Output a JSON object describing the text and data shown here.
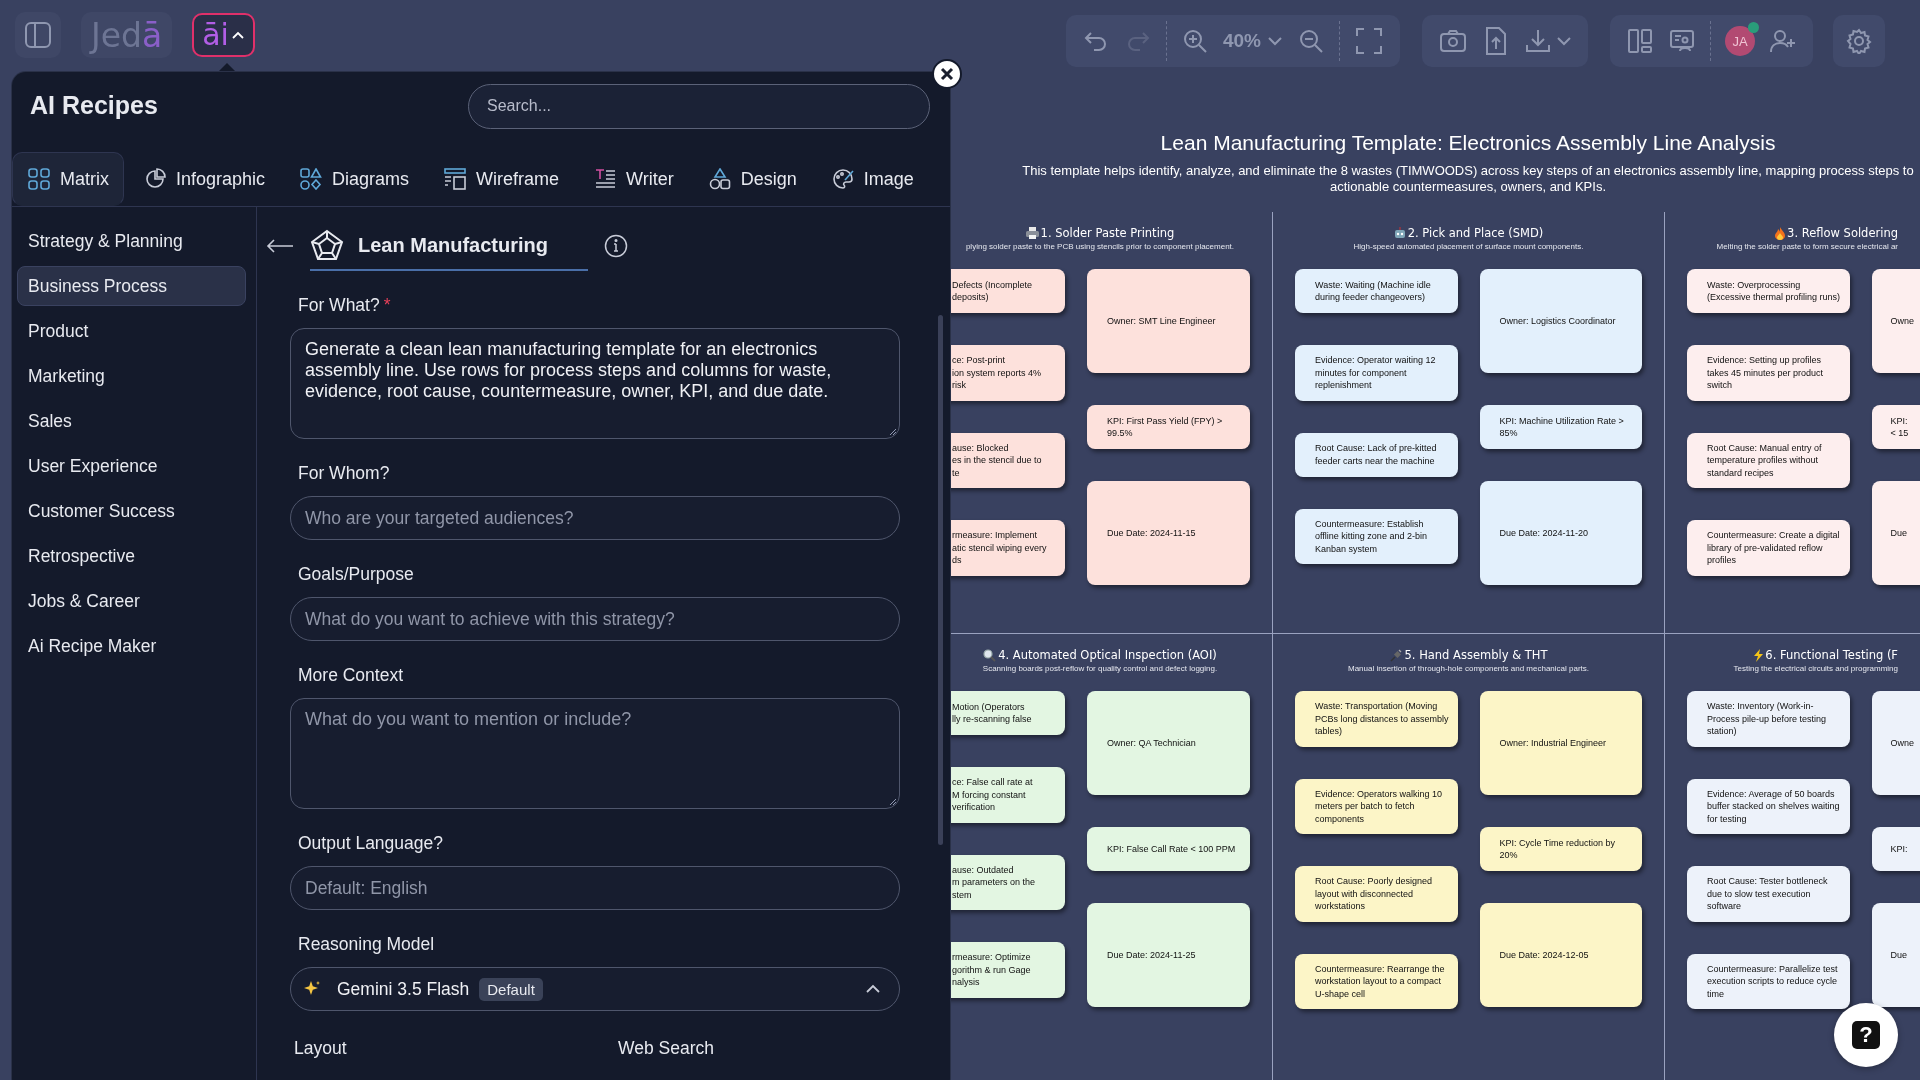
{
  "top_left": {
    "logo": {
      "text": "Jed",
      "accent": "ā"
    },
    "ai_button": {
      "text": "āi",
      "expanded": true
    }
  },
  "toolbar": {
    "undo": {
      "disabled": false
    },
    "redo": {
      "disabled": true
    },
    "zoom": "40%",
    "avatar": {
      "initials": "JA",
      "online": true
    }
  },
  "panel": {
    "title": "AI Recipes",
    "search": {
      "placeholder": "Search..."
    },
    "tabs": [
      {
        "label": "Matrix",
        "kind": "matrix",
        "selected": true
      },
      {
        "label": "Infographic",
        "kind": "infographic",
        "selected": false
      },
      {
        "label": "Diagrams",
        "kind": "diagrams",
        "selected": false
      },
      {
        "label": "Wireframe",
        "kind": "wireframe",
        "selected": false
      },
      {
        "label": "Writer",
        "kind": "writer",
        "selected": false
      },
      {
        "label": "Design",
        "kind": "design",
        "selected": false
      },
      {
        "label": "Image",
        "kind": "image",
        "selected": false
      }
    ],
    "categories": [
      {
        "label": "Strategy & Planning",
        "selected": false
      },
      {
        "label": "Business Process",
        "selected": true
      },
      {
        "label": "Product",
        "selected": false
      },
      {
        "label": "Marketing",
        "selected": false
      },
      {
        "label": "Sales",
        "selected": false
      },
      {
        "label": "User Experience",
        "selected": false
      },
      {
        "label": "Customer Success",
        "selected": false
      },
      {
        "label": "Retrospective",
        "selected": false
      },
      {
        "label": "Jobs & Career",
        "selected": false
      },
      {
        "label": "Ai Recipe Maker",
        "selected": false
      }
    ],
    "recipe": {
      "title": "Lean Manufacturing"
    },
    "required_mark": "*",
    "fields": [
      {
        "kind": "textarea",
        "label": "For What?",
        "required": true,
        "value": "Generate a clean lean manufacturing template for an electronics assembly line. Use rows for process steps and columns for waste, evidence, root cause, countermeasure, owner, KPI, and due date."
      },
      {
        "kind": "input",
        "label": "For Whom?",
        "placeholder": "Who are your targeted audiences?"
      },
      {
        "kind": "input",
        "label": "Goals/Purpose",
        "placeholder": "What do you want to achieve with this strategy?"
      },
      {
        "kind": "textarea",
        "label": "More Context",
        "placeholder": "What do you want to mention or include?"
      },
      {
        "kind": "input",
        "label": "Output Language?",
        "placeholder": "Default: English"
      },
      {
        "kind": "select",
        "label": "Reasoning Model",
        "value": "Gemini 3.5 Flash",
        "badge": "Default",
        "expanded": true
      }
    ],
    "more_labels": [
      "Layout",
      "Web Search"
    ]
  },
  "canvas": {
    "title": "Lean Manufacturing Template: Electronics Assembly Line Analysis",
    "description": "This template helps identify, analyze, and eliminate the 8 wastes (TIMWOODS) across key steps of an electronics assembly line, mapping process steps to actionable countermeasures, owners, and KPIs.",
    "rows": [
      {
        "columns": [
          {
            "kind": "printing",
            "color": "#fde1dc",
            "title": "1. Solder Paste Printing",
            "description": "plying solder paste to the PCB using stencils prior to component placement.",
            "left_cards": [
              "Defects (Incomplete\ndeposits)",
              "ce: Post-print\nion system reports 4%\nrisk",
              "ause: Blocked\nes in the stencil due to\nte",
              "rmeasure: Implement\natic stencil wiping every\nds"
            ],
            "right_cards": [
              "Owner: SMT Line Engineer",
              "KPI: First Pass Yield (FPY) > 99.5%",
              "Due Date: 2024-11-15"
            ]
          },
          {
            "kind": "placement",
            "color": "#e3f0fc",
            "title": "2. Pick and Place (SMD)",
            "description": "High-speed automated placement of surface mount components.",
            "left_cards": [
              "Waste: Waiting (Machine idle during feeder changeovers)",
              "Evidence: Operator waiting 12 minutes for component replenishment",
              "Root Cause: Lack of pre-kitted feeder carts near the machine",
              "Countermeasure: Establish offline kitting zone and 2-bin Kanban system"
            ],
            "right_cards": [
              "Owner: Logistics Coordinator",
              "KPI: Machine Utilization Rate > 85%",
              "Due Date: 2024-11-20"
            ]
          },
          {
            "kind": "reflow",
            "color": "#fdeeee",
            "title": "3. Reflow Soldering",
            "description": "Melting the solder paste to form secure electrical ar",
            "left_cards": [
              "Waste: Overprocessing (Excessive thermal profiling runs)",
              "Evidence: Setting up profiles takes 45 minutes per product switch",
              "Root Cause: Manual entry of temperature profiles without standard recipes",
              "Countermeasure: Create a digital library of pre-validated reflow profiles"
            ],
            "right_cards": [
              "Owne",
              "KPI:\n< 15",
              "Due"
            ]
          }
        ]
      },
      {
        "columns": [
          {
            "kind": "inspection",
            "color": "#e3f6e2",
            "title": "4. Automated Optical Inspection (AOI)",
            "description": "Scanning boards post-reflow for quality control and defect logging.",
            "left_cards": [
              "Motion (Operators\nlly re-scanning false",
              "ce: False call rate at\nM forcing constant\nverification",
              "ause: Outdated\nm parameters on the\nstem",
              "rmeasure: Optimize\ngorithm & run Gage\nnalysis"
            ],
            "right_cards": [
              "Owner: QA Technician",
              "KPI: False Call Rate < 100 PPM",
              "Due Date: 2024-11-25"
            ]
          },
          {
            "kind": "assembly",
            "color": "#fcf5c7",
            "title": "5. Hand Assembly & THT",
            "description": "Manual insertion of through-hole components and mechanical parts.",
            "left_cards": [
              "Waste: Transportation (Moving PCBs long distances to assembly tables)",
              "Evidence: Operators walking 10 meters per batch to fetch components",
              "Root Cause: Poorly designed layout with disconnected workstations",
              "Countermeasure: Rearrange the workstation layout to a compact U-shape cell"
            ],
            "right_cards": [
              "Owner: Industrial Engineer",
              "KPI: Cycle Time reduction by 20%",
              "Due Date: 2024-12-05"
            ]
          },
          {
            "kind": "testing",
            "color": "#edf2fa",
            "title": "6. Functional Testing (F",
            "description": "Testing the electrical circuits and programming",
            "left_cards": [
              "Waste: Inventory (Work-in-Process pile-up before testing station)",
              "Evidence: Average of 50 boards buffer stacked on shelves waiting for testing",
              "Root Cause: Tester bottleneck due to slow test execution software",
              "Countermeasure: Parallelize test execution scripts to reduce cycle time"
            ],
            "right_cards": [
              "Owne",
              "KPI:",
              "Due"
            ]
          }
        ]
      }
    ]
  },
  "help_button": {
    "glyph": "?"
  }
}
